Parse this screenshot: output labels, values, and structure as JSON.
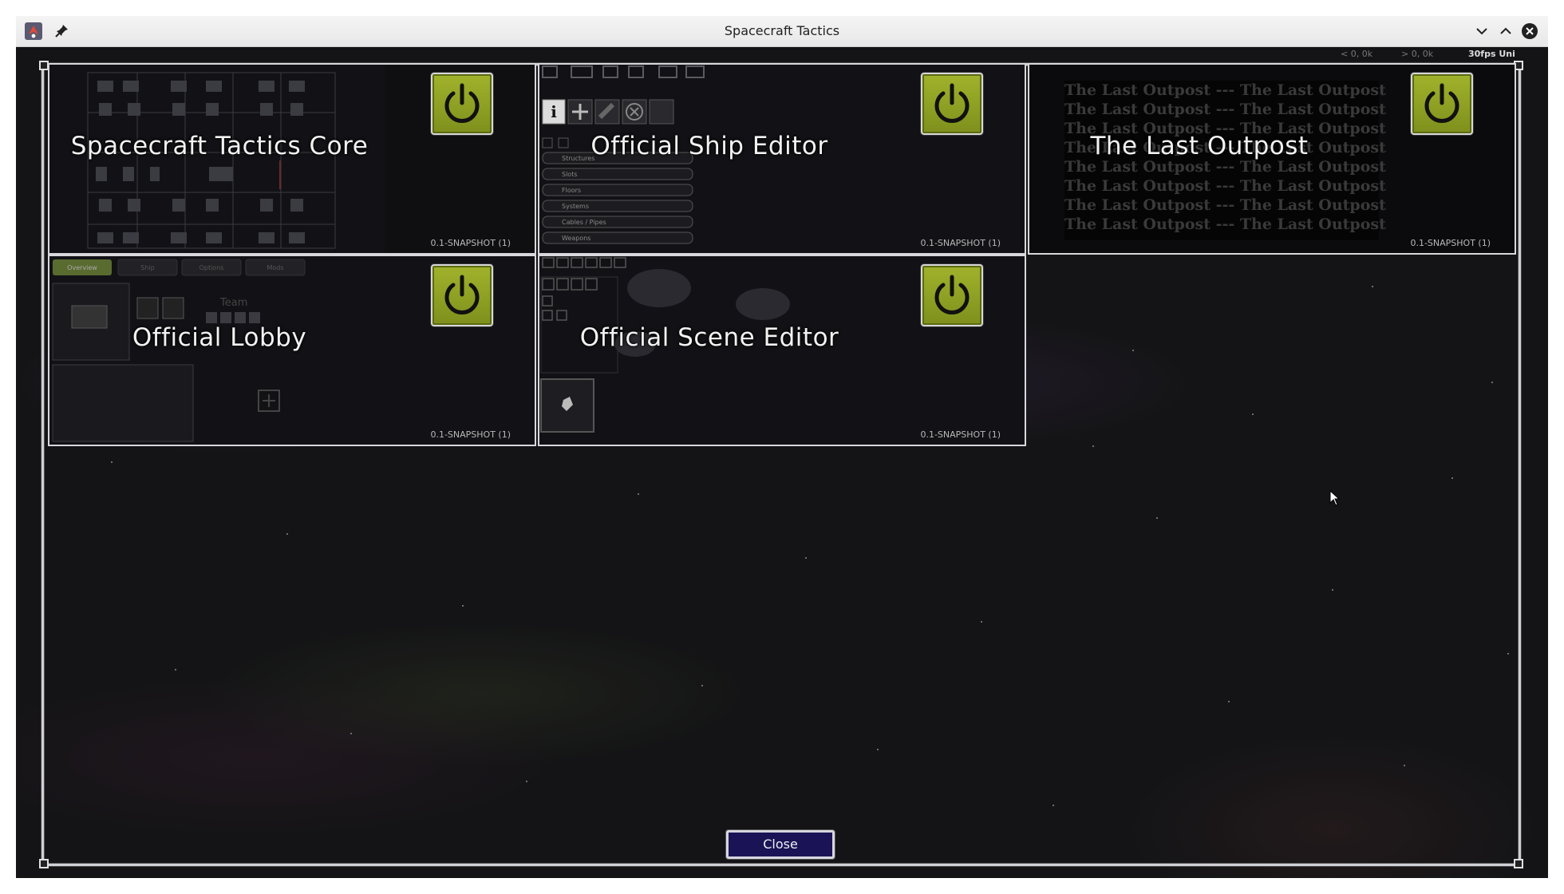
{
  "window": {
    "title": "Spacecraft Tactics"
  },
  "hud": {
    "fps_text": "30fps Uni",
    "readout_left": "< 0, 0k",
    "readout_right": "> 0, 0k"
  },
  "tiles": [
    {
      "name": "Spacecraft Tactics Core",
      "version": "0.1-SNAPSHOT (1)"
    },
    {
      "name": "Official Ship Editor",
      "version": "0.1-SNAPSHOT (1)"
    },
    {
      "name": "The Last Outpost",
      "version": "0.1-SNAPSHOT (1)"
    },
    {
      "name": "Official Lobby",
      "version": "0.1-SNAPSHOT (1)"
    },
    {
      "name": "Official Scene Editor",
      "version": "0.1-SNAPSHOT (1)"
    }
  ],
  "preview_texts": {
    "last_outpost_line": "The Last Outpost --- The Last Outpost",
    "ship_editor_list": [
      "Structures",
      "Slots",
      "Floors",
      "Systems",
      "Cables / Pipes",
      "Weapons"
    ],
    "lobby_tabs": [
      "Overview",
      "Ship",
      "Options",
      "Mods"
    ],
    "lobby_team": "Team"
  },
  "footer": {
    "close_label": "Close"
  },
  "colors": {
    "power_button": "#91a324",
    "close_button": "#1a1457",
    "frame": "#d7d7dc"
  }
}
